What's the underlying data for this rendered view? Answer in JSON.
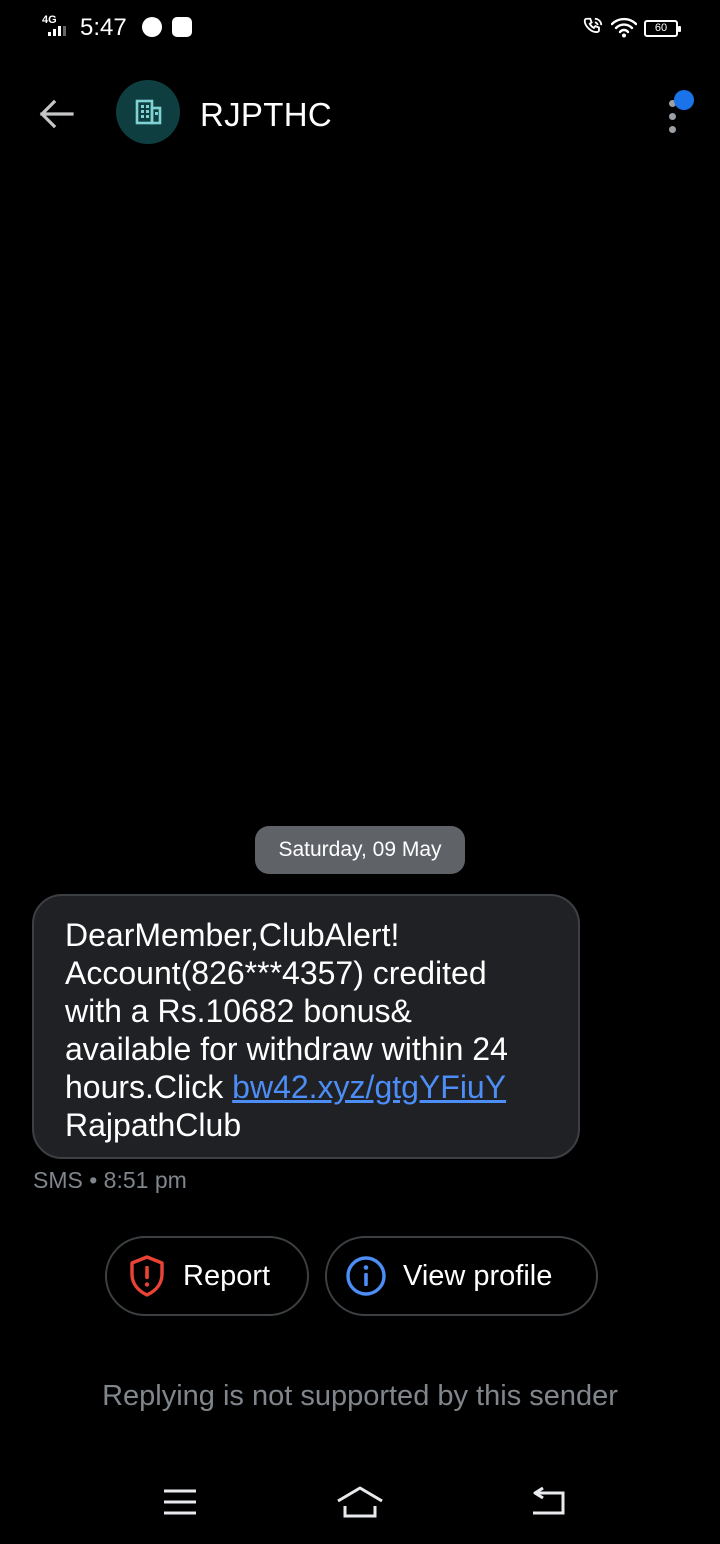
{
  "status_bar": {
    "network": "4G",
    "time": "5:47",
    "battery": "60"
  },
  "header": {
    "sender": "RJPTHC",
    "avatar_icon": "building-icon",
    "menu_icon": "more-vert-icon",
    "badge_color": "#1a73e8"
  },
  "conversation": {
    "date": "Saturday, 09 May",
    "message": {
      "text_before_link": "DearMember,ClubAlert!\nAccount(826***4357) credited\nwith a Rs.10682 bonus&\navailable for withdraw within 24\nhours.Click ",
      "link": "bw42.xyz/gtgYFiuY",
      "text_after_link": "\nRajpathClub",
      "meta": "SMS • 8:51 pm"
    }
  },
  "actions": {
    "report_label": "Report",
    "view_profile_label": "View profile"
  },
  "reply_note": "Replying is not supported by this sender",
  "colors": {
    "accent": "#1a73e8",
    "link": "#4c8df6",
    "report": "#ea4335",
    "avatar_bg": "#0f3e40"
  }
}
